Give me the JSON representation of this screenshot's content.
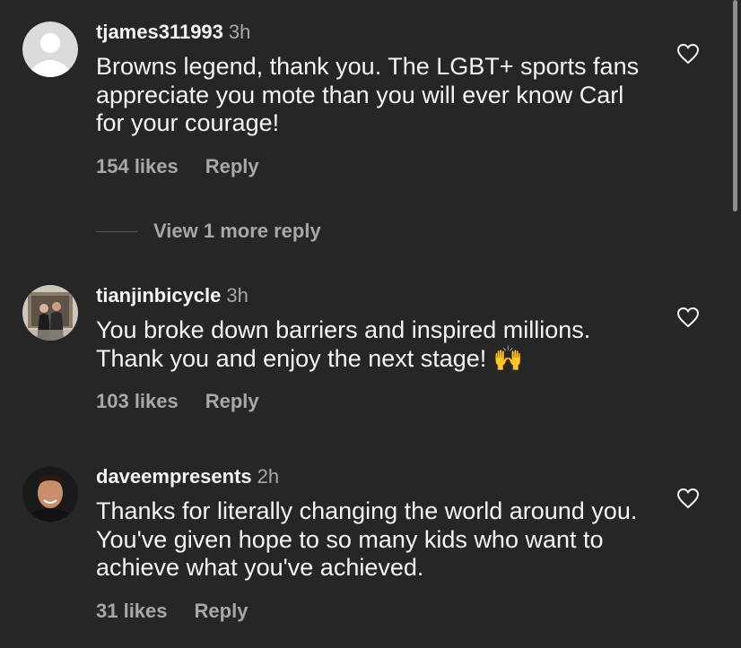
{
  "comments": [
    {
      "username": "tjames311993",
      "time": "3h",
      "text": "Browns legend, thank you. The LGBT+ sports fans appreciate you mote than you will ever know Carl for your courage!",
      "likes": "154 likes",
      "reply": "Reply",
      "avatar_icon": "default-avatar-icon"
    },
    {
      "username": "tianjinbicycle",
      "time": "3h",
      "text": "You broke down barriers and inspired millions. Thank you and enjoy the next stage!",
      "emoji": "🙌",
      "likes": "103 likes",
      "reply": "Reply",
      "avatar_icon": "couple-photo-avatar"
    },
    {
      "username": "daveempresents",
      "time": "2h",
      "text": "Thanks for literally changing the world around you. You've given hope to so many kids who want to achieve what you've achieved.",
      "likes": "31 likes",
      "reply": "Reply",
      "avatar_icon": "man-portrait-avatar"
    }
  ],
  "view_more": "View 1 more reply",
  "colors": {
    "background": "#262626",
    "primary_text": "#f5f5f5",
    "secondary_text": "#a8a8a8"
  }
}
